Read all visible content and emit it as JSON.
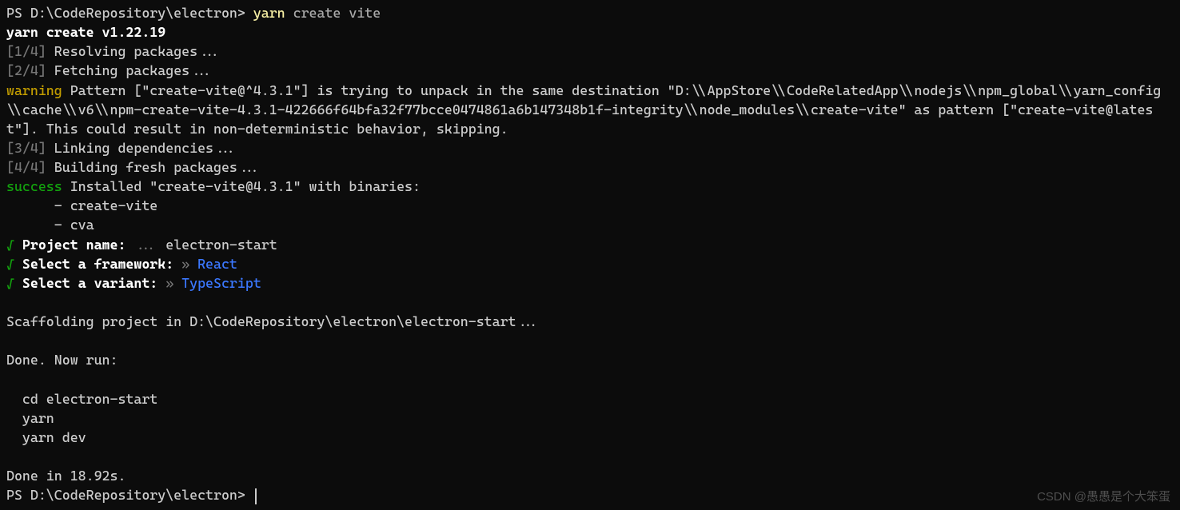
{
  "prompt1": {
    "path": "PS D:\\CodeRepository\\electron> ",
    "cmd_highlight": "yarn",
    "cmd_rest": " create vite"
  },
  "yarn_version": "yarn create v1.22.19",
  "steps": {
    "s1_num": "[1/4]",
    "s1_text": " Resolving packages...",
    "s2_num": "[2/4]",
    "s2_text": " Fetching packages...",
    "s3_num": "[3/4]",
    "s3_text": " Linking dependencies...",
    "s4_num": "[4/4]",
    "s4_text": " Building fresh packages..."
  },
  "warning_label": "warning",
  "warning_text": " Pattern [\"create-vite@^4.3.1\"] is trying to unpack in the same destination \"D:\\\\AppStore\\\\CodeRelatedApp\\\\nodejs\\\\npm_global\\\\yarn_config\\\\cache\\\\v6\\\\npm-create-vite-4.3.1-422666f64bfa32f77bcce0474861a6b147348b1f-integrity\\\\node_modules\\\\create-vite\" as pattern [\"create-vite@latest\"]. This could result in non-deterministic behavior, skipping.",
  "success_label": "success",
  "success_text": " Installed \"create-vite@4.3.1\" with binaries:",
  "binaries": {
    "b1": "      - create-vite",
    "b2": "      - cva"
  },
  "qa": {
    "check": "√",
    "q1_label": " Project name: ",
    "q1_ellipsis": "...",
    "q1_answer": " electron-start",
    "q2_label": " Select a framework: ",
    "q2_arrow": "»",
    "q2_answer": " React",
    "q3_label": " Select a variant: ",
    "q3_arrow": "»",
    "q3_answer": " TypeScript"
  },
  "scaffold": "Scaffolding project in D:\\CodeRepository\\electron\\electron-start...",
  "done_label": "Done. Now run:",
  "run_cmds": {
    "c1": "  cd electron-start",
    "c2": "  yarn",
    "c3": "  yarn dev"
  },
  "done_time": "Done in 18.92s.",
  "prompt2": "PS D:\\CodeRepository\\electron> ",
  "watermark": "CSDN @愚愚是个大笨蛋"
}
